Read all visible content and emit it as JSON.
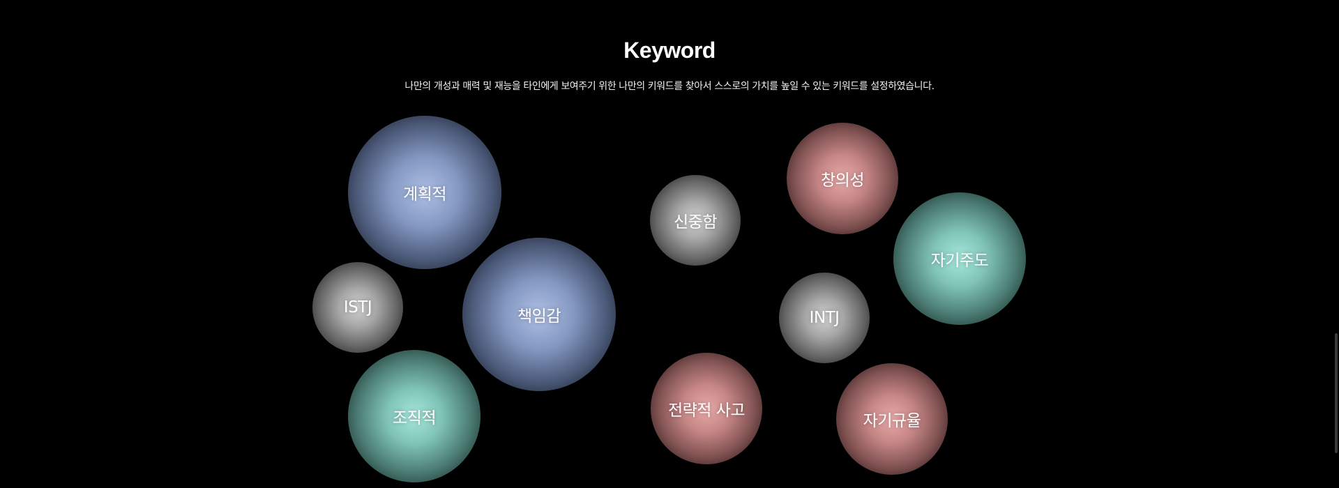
{
  "section": {
    "title": "Keyword",
    "description": "나만의 개성과 매력 및 재능을 타인에게 보여주기 위한 나만의 키워드를 찾아서 스스로의 가치를 높일 수 있는 키워드를 설정하였습니다."
  },
  "keywords": [
    {
      "label": "계획적",
      "tone": "blue"
    },
    {
      "label": "ISTJ",
      "tone": "gray"
    },
    {
      "label": "책임감",
      "tone": "blue"
    },
    {
      "label": "조직적",
      "tone": "teal"
    },
    {
      "label": "신중함",
      "tone": "gray"
    },
    {
      "label": "창의성",
      "tone": "pink"
    },
    {
      "label": "자기주도",
      "tone": "teal"
    },
    {
      "label": "INTJ",
      "tone": "gray"
    },
    {
      "label": "전략적 사고",
      "tone": "pink"
    },
    {
      "label": "자기규율",
      "tone": "pink"
    }
  ],
  "colors": {
    "background": "#000000",
    "text": "#ffffff",
    "blue": "#aebfe4",
    "gray": "#d2d2d2",
    "teal": "#a6e8dc",
    "pink": "#e7aaa9"
  }
}
